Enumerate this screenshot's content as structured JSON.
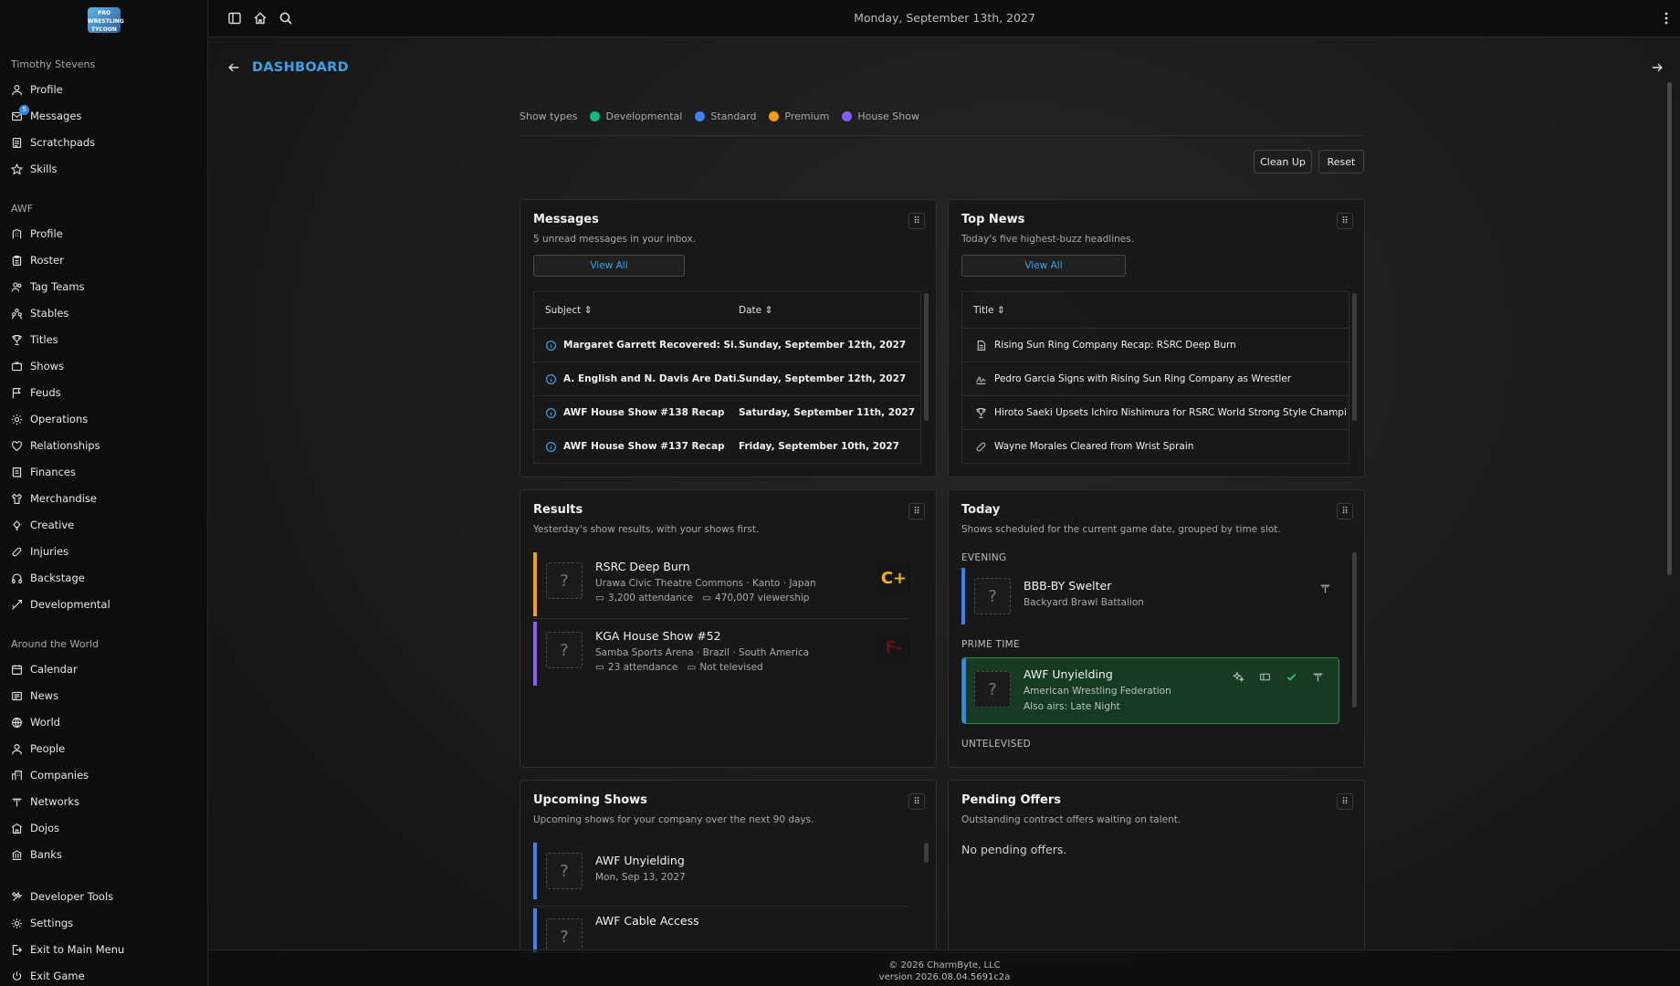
{
  "sidebar": {
    "logo_text": "PRO WRESTLING TYCOON",
    "user_section": "Timothy Stevens",
    "user_items": [
      {
        "label": "Profile",
        "icon": "user-icon"
      },
      {
        "label": "Messages",
        "icon": "messages-icon",
        "badge": "5"
      },
      {
        "label": "Scratchpads",
        "icon": "notepad-icon"
      },
      {
        "label": "Skills",
        "icon": "star-icon"
      }
    ],
    "company_section": "AWF",
    "company_items": [
      {
        "label": "Profile",
        "icon": "building-icon"
      },
      {
        "label": "Roster",
        "icon": "clipboard-icon"
      },
      {
        "label": "Tag Teams",
        "icon": "users-icon"
      },
      {
        "label": "Stables",
        "icon": "group-icon"
      },
      {
        "label": "Titles",
        "icon": "trophy-icon"
      },
      {
        "label": "Shows",
        "icon": "tv-icon"
      },
      {
        "label": "Feuds",
        "icon": "flag-icon"
      },
      {
        "label": "Operations",
        "icon": "cog-icon"
      },
      {
        "label": "Relationships",
        "icon": "heart-icon"
      },
      {
        "label": "Finances",
        "icon": "receipt-icon"
      },
      {
        "label": "Merchandise",
        "icon": "shirt-icon"
      },
      {
        "label": "Creative",
        "icon": "bulb-icon"
      },
      {
        "label": "Injuries",
        "icon": "bandage-icon"
      },
      {
        "label": "Backstage",
        "icon": "headphones-icon"
      },
      {
        "label": "Developmental",
        "icon": "growth-icon"
      }
    ],
    "world_section": "Around the World",
    "world_items": [
      {
        "label": "Calendar",
        "icon": "calendar-icon"
      },
      {
        "label": "News",
        "icon": "news-icon"
      },
      {
        "label": "World",
        "icon": "globe-icon"
      },
      {
        "label": "People",
        "icon": "person-icon"
      },
      {
        "label": "Companies",
        "icon": "companies-icon"
      },
      {
        "label": "Networks",
        "icon": "antenna-icon"
      },
      {
        "label": "Dojos",
        "icon": "dojo-icon"
      },
      {
        "label": "Banks",
        "icon": "bank-icon"
      }
    ],
    "bottom_items": [
      {
        "label": "Developer Tools",
        "icon": "tools-icon"
      },
      {
        "label": "Settings",
        "icon": "settings-icon"
      },
      {
        "label": "Exit to Main Menu",
        "icon": "exit-menu-icon"
      },
      {
        "label": "Exit Game",
        "icon": "power-icon"
      }
    ]
  },
  "topbar": {
    "date": "Monday, September 13th, 2027"
  },
  "page": {
    "title": "DASHBOARD"
  },
  "legend": {
    "label": "Show types",
    "items": [
      {
        "label": "Developmental",
        "color": "#10b981"
      },
      {
        "label": "Standard",
        "color": "#3b82f6"
      },
      {
        "label": "Premium",
        "color": "#f59e0b"
      },
      {
        "label": "House Show",
        "color": "#8b5cf6"
      }
    ]
  },
  "actions": {
    "cleanup": "Clean Up",
    "reset": "Reset"
  },
  "messages": {
    "title": "Messages",
    "subtitle": "5 unread messages in your inbox.",
    "view_all": "View All",
    "col_subject": "Subject",
    "col_date": "Date",
    "rows": [
      {
        "subject": "Margaret Garrett Recovered: Si...",
        "date": "Sunday, September 12th, 2027"
      },
      {
        "subject": "A. English and N. Davis Are Dati...",
        "date": "Sunday, September 12th, 2027"
      },
      {
        "subject": "AWF House Show #138 Recap",
        "date": "Saturday, September 11th, 2027"
      },
      {
        "subject": "AWF House Show #137 Recap",
        "date": "Friday, September 10th, 2027"
      }
    ]
  },
  "news": {
    "title": "Top News",
    "subtitle": "Today's five highest-buzz headlines.",
    "view_all": "View All",
    "col_title": "Title",
    "rows": [
      {
        "title": "Rising Sun Ring Company Recap: RSRC Deep Burn",
        "icon": "document-icon"
      },
      {
        "title": "Pedro Garcia Signs with Rising Sun Ring Company as Wrestler",
        "icon": "signature-icon"
      },
      {
        "title": "Hiroto Saeki Upsets Ichiro Nishimura for RSRC World Strong Style Champi...",
        "icon": "trophy-icon"
      },
      {
        "title": "Wayne Morales Cleared from Wrist Sprain",
        "icon": "bandage-icon"
      }
    ]
  },
  "results": {
    "title": "Results",
    "subtitle": "Yesterday's show results, with your shows first.",
    "rows": [
      {
        "name": "RSRC Deep Burn",
        "venue": "Urawa Civic Theatre Commons · Kanto · Japan",
        "attendance": "3,200 attendance",
        "viewership": "470,007 viewership",
        "grade": "C+",
        "grade_color": "#f5b400",
        "bar_color": "#f59e0b"
      },
      {
        "name": "KGA House Show #52",
        "venue": "Samba Sports Arena · Brazil · South America",
        "attendance": "23 attendance",
        "viewership": "Not televised",
        "grade": "F-",
        "grade_color": "#5a1414",
        "bar_color": "#8b5cf6"
      }
    ]
  },
  "today": {
    "title": "Today",
    "subtitle": "Shows scheduled for the current game date, grouped by time slot.",
    "slot_evening": "EVENING",
    "slot_prime": "PRIME TIME",
    "slot_untelevised": "UNTELEVISED",
    "evening_show": {
      "name": "BBB-BY Swelter",
      "company": "Backyard Brawl Battalion"
    },
    "prime_show": {
      "name": "AWF Unyielding",
      "company": "American Wrestling Federation",
      "also": "Also airs: Late Night"
    }
  },
  "upcoming": {
    "title": "Upcoming Shows",
    "subtitle": "Upcoming shows for your company over the next 90 days.",
    "rows": [
      {
        "name": "AWF Unyielding",
        "date": "Mon, Sep 13, 2027"
      },
      {
        "name": "AWF Cable Access",
        "date": ""
      }
    ]
  },
  "offers": {
    "title": "Pending Offers",
    "subtitle": "Outstanding contract offers waiting on talent.",
    "empty": "No pending offers."
  },
  "footer": {
    "copyright": "© 2026 CharmByte, LLC",
    "version": "version 2026.08.04.5691c2a"
  }
}
